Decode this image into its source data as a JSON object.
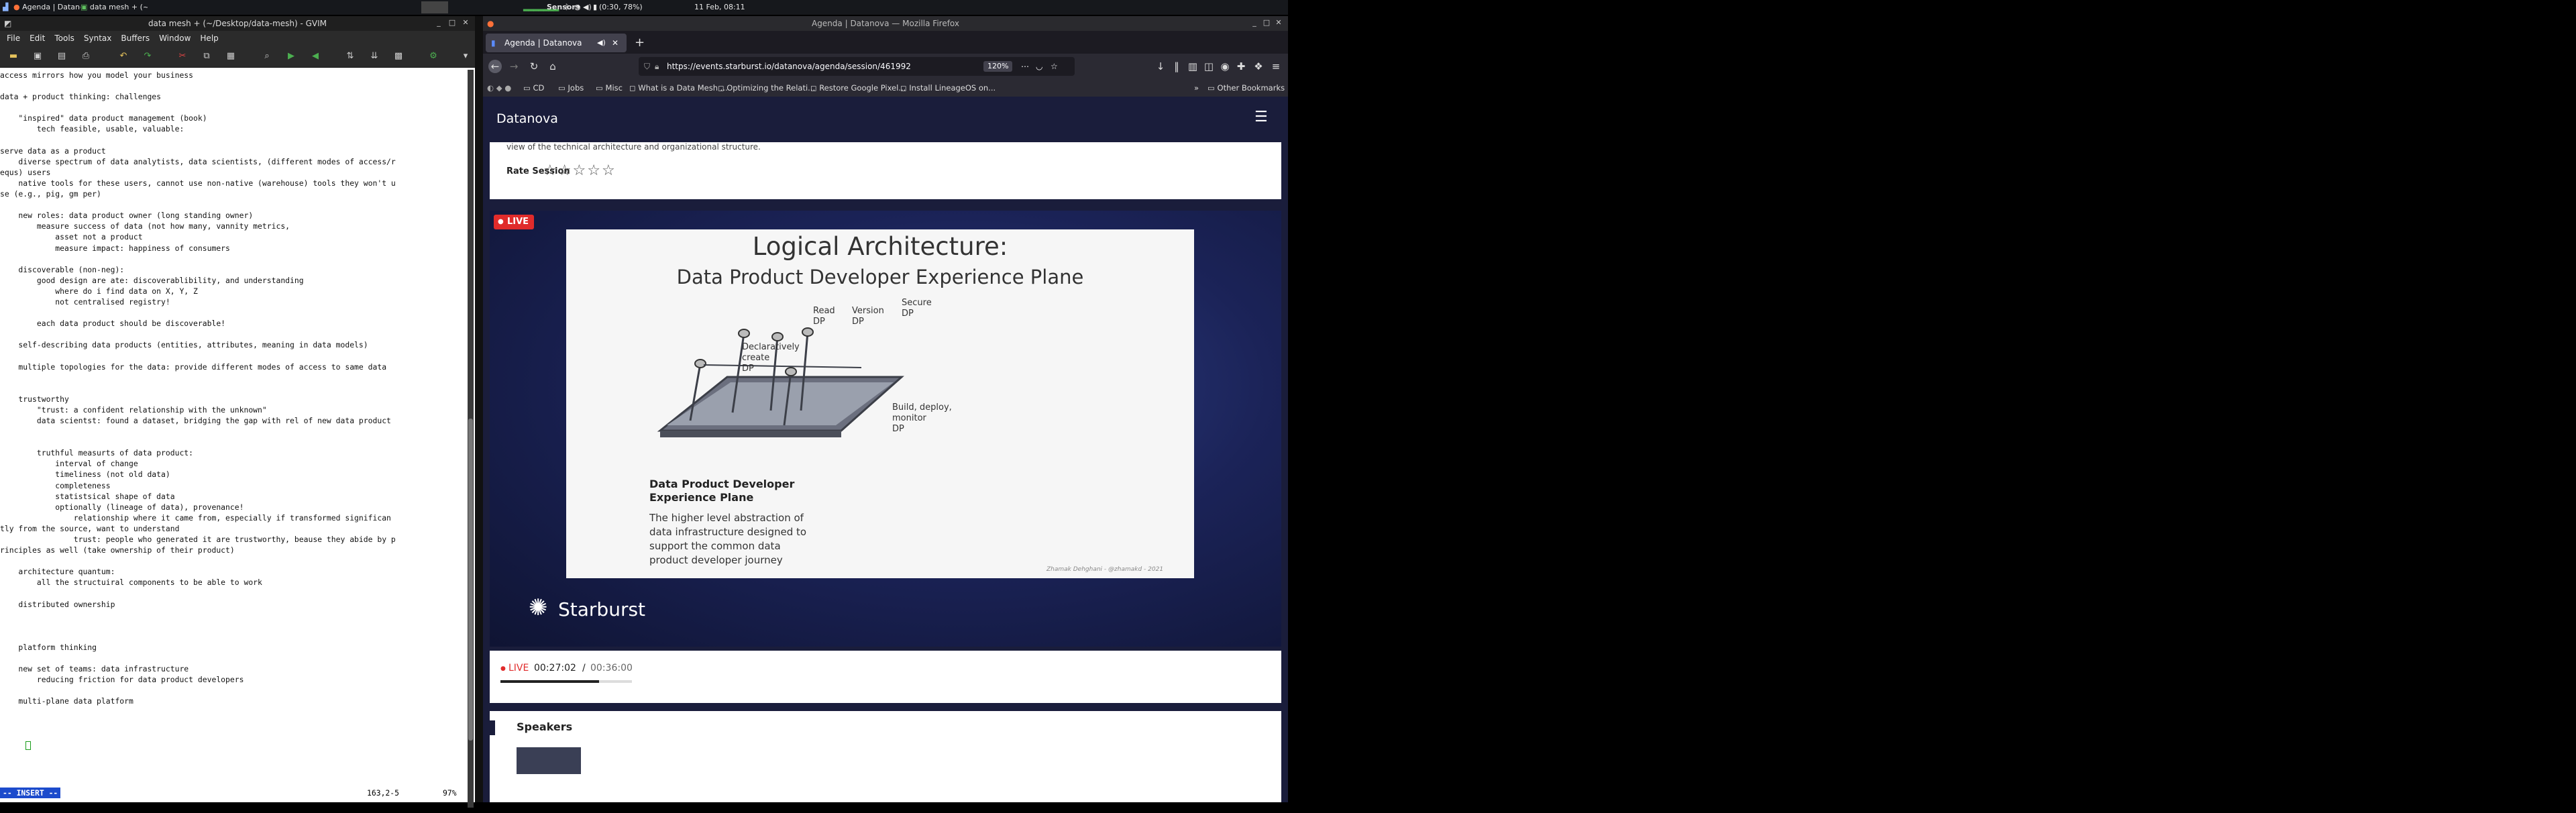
{
  "taskbar": {
    "tasks": [
      "Agenda | Datanova — Mozil…",
      "data mesh + (~/Desktop/dat…"
    ],
    "sensors": "Sensors",
    "battery": "(0:30, 78%)",
    "clock": "11 Feb, 08:11"
  },
  "gvim": {
    "title": "data mesh + (~/Desktop/data-mesh) - GVIM",
    "menu": [
      "File",
      "Edit",
      "Tools",
      "Syntax",
      "Buffers",
      "Window",
      "Help"
    ],
    "lines": [
      "access mirrors how you model your business",
      "",
      "data + product thinking: challenges",
      "",
      "    \"inspired\" data product management (book)",
      "        tech feasible, usable, valuable:",
      "",
      "serve data as a product",
      "    diverse spectrum of data analytists, data scientists, (different modes of access/r",
      "equs) users",
      "    native tools for these users, cannot use non-native (warehouse) tools they won't u",
      "se (e.g., pig, gm per)",
      "",
      "    new roles: data product owner (long standing owner)",
      "        measure success of data (not how many, vannity metrics,",
      "            asset not a product",
      "            measure impact: happiness of consumers",
      "",
      "    discoverable (non-neg):",
      "        good design are ate: discoverablibility, and understanding",
      "            where do i find data on X, Y, Z",
      "            not centralised registry!",
      "",
      "        each data product should be discoverable!",
      "",
      "    self-describing data products (entities, attributes, meaning in data models)",
      "",
      "    multiple topologies for the data: provide different modes of access to same data",
      "",
      "",
      "    trustworthy",
      "        \"trust: a confident relationship with the unknown\"",
      "        data scientst: found a dataset, bridging the gap with rel of new data product",
      "",
      "",
      "        truthful measurts of data product:",
      "            interval of change",
      "            timeliness (not old data)",
      "            completeness",
      "            statistsical shape of data",
      "            optionally (lineage of data), provenance!",
      "                relationship where it came from, especially if transformed significan",
      "tly from the source, want to understand",
      "                trust: people who generated it are trustworthy, beause they abide by p",
      "rinciples as well (take ownership of their product)",
      "",
      "    architecture quantum:",
      "        all the structuiral components to be able to work",
      "",
      "    distributed ownership",
      "",
      "",
      "",
      "    platform thinking",
      "",
      "    new set of teams: data infrastructure",
      "        reducing friction for data product developers",
      "",
      "    multi-plane data platform",
      "",
      ""
    ],
    "mode": "-- INSERT --",
    "position": "163,2-5",
    "percent": "97%"
  },
  "firefox": {
    "title": "Agenda | Datanova — Mozilla Firefox",
    "tab_label": "Agenda | Datanova",
    "url": "https://events.starburst.io/datanova/agenda/session/461992",
    "zoom": "120%",
    "bookmarks": [
      "CD",
      "Jobs",
      "Misc",
      "What is a Data Mesh ...",
      "Optimizing the Relati...",
      "Restore Google Pixel...",
      "Install LineageOS on..."
    ],
    "other_bookmarks": "Other Bookmarks"
  },
  "site": {
    "brand": "Datanova",
    "desc_tail": "view of the technical architecture and organizational structure.",
    "rate_label": "Rate Session",
    "live_badge": "LIVE",
    "slide": {
      "title": "Logical Architecture:",
      "subtitle": "Data Product Developer Experience Plane",
      "labels": {
        "declare": [
          "Declaratively",
          "create",
          "DP"
        ],
        "read": [
          "Read",
          "DP"
        ],
        "version": [
          "Version",
          "DP"
        ],
        "secure": [
          "Secure",
          "DP"
        ],
        "build": [
          "Build, deploy,",
          "monitor",
          "DP"
        ]
      },
      "plane_name": [
        "Data Product Developer",
        "Experience Plane"
      ],
      "description": [
        "The higher level abstraction of",
        "data infrastructure designed to",
        "support the common data",
        "product developer journey"
      ],
      "credit": "Zhamak Dehghani - @zhamakd - 2021"
    },
    "sponsor": "Starburst",
    "player": {
      "live": "LIVE",
      "current": "00:27:02",
      "separator": "/",
      "total": "00:36:00",
      "progress": 0.751
    },
    "speakers_heading": "Speakers"
  },
  "colors": {
    "accent_red": "#e02b2b",
    "insert_blue": "#1c4bcc",
    "site_navy": "#1a1d3b"
  }
}
